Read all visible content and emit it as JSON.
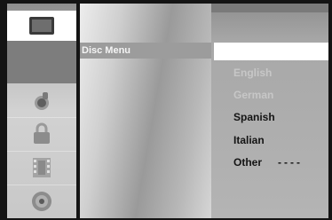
{
  "sidebar": {
    "items": [
      {
        "icon": "tv-screen-icon"
      },
      {
        "icon": "blank-zone"
      },
      {
        "icon": "speaker-icon"
      },
      {
        "icon": "lock-icon"
      },
      {
        "icon": "film-icon"
      },
      {
        "icon": "disc-icon"
      }
    ]
  },
  "middle": {
    "highlighted_label": "Disc Menu"
  },
  "options": {
    "items": [
      {
        "label": "English",
        "state": "faded"
      },
      {
        "label": "German",
        "state": "faded"
      },
      {
        "label": "Spanish",
        "state": "normal"
      },
      {
        "label": "Italian",
        "state": "normal"
      },
      {
        "label": "Other",
        "state": "normal"
      }
    ],
    "other_value": "----"
  }
}
